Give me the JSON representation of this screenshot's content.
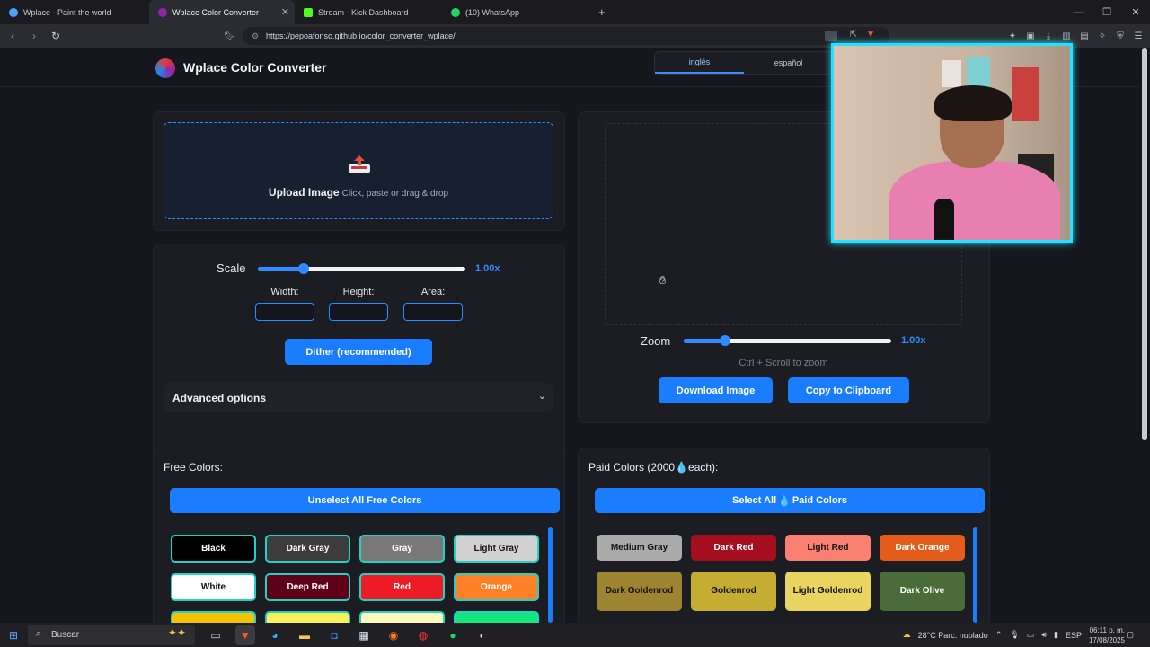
{
  "browser": {
    "tabs": [
      {
        "label": "Wplace - Paint the world",
        "color": "#4aa3ff"
      },
      {
        "label": "Wplace Color Converter",
        "color": "#8e24aa"
      },
      {
        "label": "Stream - Kick Dashboard",
        "color": "#53fc18"
      },
      {
        "label": "(10) WhatsApp",
        "color": "#25d366"
      }
    ],
    "new_tab": "+",
    "url": "https://pepoafonso.github.io/color_converter_wplace/"
  },
  "header": {
    "title": "Wplace Color Converter",
    "lang_active": "inglés",
    "lang_other": "español"
  },
  "upload": {
    "title": "Upload Image",
    "subtitle": "Click, paste or drag & drop"
  },
  "controls": {
    "scale_label": "Scale",
    "scale_value": "1.00x",
    "scale_level": 0.22,
    "width_label": "Width:",
    "height_label": "Height:",
    "area_label": "Area:",
    "dither_button": "Dither (recommended)",
    "advanced_label": "Advanced options"
  },
  "preview": {
    "zoom_label": "Zoom",
    "zoom_value": "1.00x",
    "zoom_level": 0.2,
    "hint": "Ctrl + Scroll to zoom",
    "download_button": "Download Image",
    "copy_button": "Copy to Clipboard"
  },
  "free_colors": {
    "title": "Free Colors:",
    "toggle_button": "Unselect All Free Colors",
    "items": [
      {
        "label": "Black",
        "bg": "#000000",
        "fg": "#ffffff"
      },
      {
        "label": "Dark Gray",
        "bg": "#3c3c3c",
        "fg": "#ffffff"
      },
      {
        "label": "Gray",
        "bg": "#787878",
        "fg": "#ffffff"
      },
      {
        "label": "Light Gray",
        "bg": "#d2d2d2",
        "fg": "#111111"
      },
      {
        "label": "White",
        "bg": "#ffffff",
        "fg": "#111111"
      },
      {
        "label": "Deep Red",
        "bg": "#600018",
        "fg": "#ffffff"
      },
      {
        "label": "Red",
        "bg": "#ed1c24",
        "fg": "#ffffff"
      },
      {
        "label": "Orange",
        "bg": "#ff7f27",
        "fg": "#ffffff"
      }
    ]
  },
  "paid_colors": {
    "title_prefix": "Paid Colors (2000",
    "title_suffix": "each):",
    "drop_icon": "💧",
    "toggle_prefix": "Select All ",
    "toggle_suffix": "Paid Colors",
    "items": [
      {
        "label": "Medium Gray",
        "bg": "#aaaaaa",
        "fg": "#111111"
      },
      {
        "label": "Dark Red",
        "bg": "#a50e1e",
        "fg": "#ffffff"
      },
      {
        "label": "Light Red",
        "bg": "#fa8072",
        "fg": "#111111"
      },
      {
        "label": "Dark Orange",
        "bg": "#e45c1a",
        "fg": "#ffffff"
      },
      {
        "label": "Dark Goldenrod",
        "bg": "#9c8431",
        "fg": "#111111"
      },
      {
        "label": "Goldenrod",
        "bg": "#c5ad31",
        "fg": "#111111"
      },
      {
        "label": "Light Goldenrod",
        "bg": "#e8d45f",
        "fg": "#111111"
      },
      {
        "label": "Dark Olive",
        "bg": "#4a6b3a",
        "fg": "#ffffff"
      }
    ]
  },
  "taskbar": {
    "search_placeholder": "Buscar",
    "weather": "28°C  Parc. nublado",
    "lang": "ESP",
    "time": "06:11 p. m.",
    "date": "17/08/2025"
  }
}
